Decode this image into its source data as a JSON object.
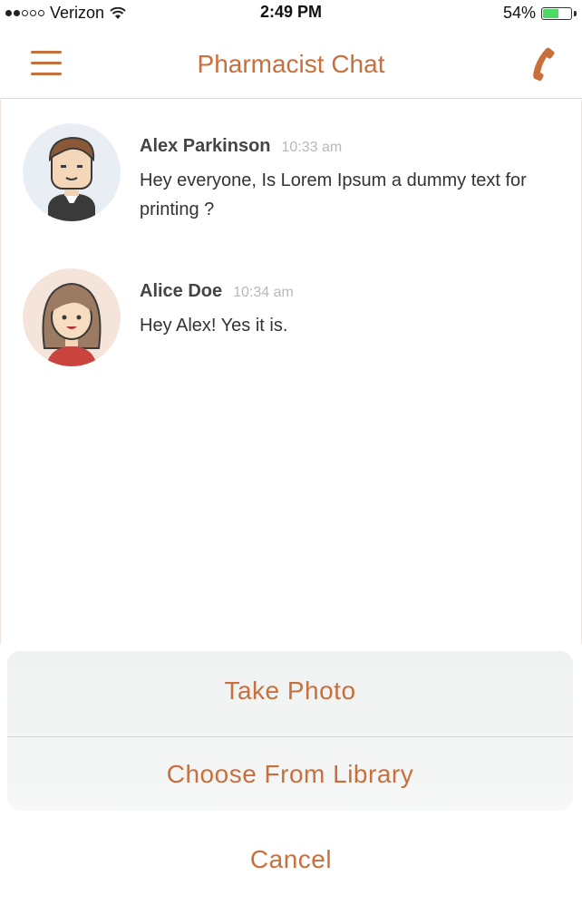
{
  "status_bar": {
    "carrier": "Verizon",
    "time": "2:49 PM",
    "battery": "54%",
    "battery_level": 0.54,
    "signal_bars_filled": 2,
    "signal_bars_total": 5
  },
  "nav": {
    "title": "Pharmacist Chat",
    "menu_icon": "hamburger-icon",
    "call_icon": "phone-icon"
  },
  "messages": [
    {
      "sender": "Alex Parkinson",
      "time": "10:33 am",
      "text": "Hey everyone, Is Lorem Ipsum a dummy text for printing ?"
    },
    {
      "sender": "Alice Doe",
      "time": "10:34 am",
      "text": "Hey Alex! Yes it is."
    }
  ],
  "action_sheet": {
    "take_photo": "Take Photo",
    "choose_library": "Choose From Library",
    "cancel": "Cancel"
  },
  "colors": {
    "accent": "#c8703d",
    "battery": "#4cd964"
  }
}
